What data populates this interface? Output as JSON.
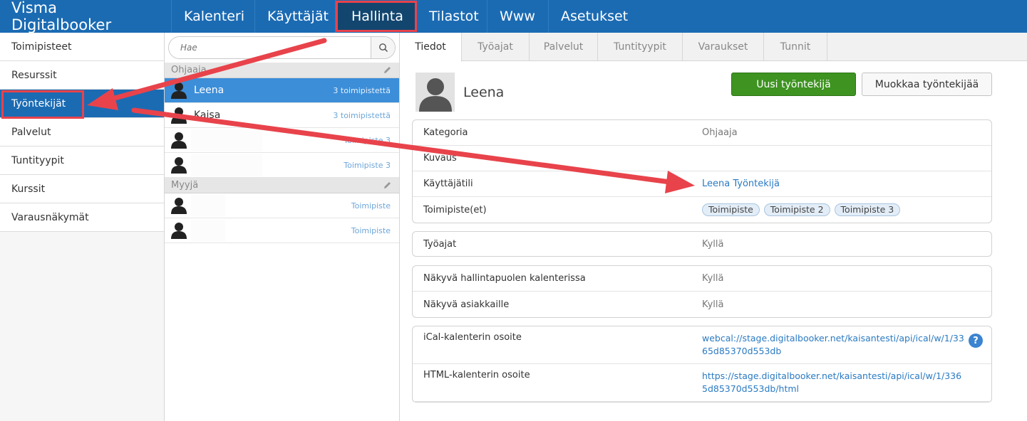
{
  "nav": {
    "brand": "Visma Digitalbooker",
    "items": [
      {
        "label": "Kalenteri"
      },
      {
        "label": "Käyttäjät"
      },
      {
        "label": "Hallinta"
      },
      {
        "label": "Tilastot"
      },
      {
        "label": "Www"
      },
      {
        "label": "Asetukset"
      }
    ]
  },
  "sidebar": {
    "items": [
      {
        "label": "Toimipisteet"
      },
      {
        "label": "Resurssit"
      },
      {
        "label": "Työntekijät"
      },
      {
        "label": "Palvelut"
      },
      {
        "label": "Tuntityypit"
      },
      {
        "label": "Kurssit"
      },
      {
        "label": "Varausnäkymät"
      }
    ]
  },
  "search": {
    "placeholder": "Hae"
  },
  "groups": [
    {
      "name": "Ohjaaja",
      "employees": [
        {
          "name": "Leena",
          "locations": "3 toimipistettä"
        },
        {
          "name": "Kaisa",
          "locations": "3 toimipistettä"
        },
        {
          "name": "",
          "locations": "Toimipiste 3"
        },
        {
          "name": "",
          "locations": "Toimipiste 3"
        }
      ]
    },
    {
      "name": "Myyjä",
      "employees": [
        {
          "name": "",
          "locations": "Toimipiste"
        },
        {
          "name": "",
          "locations": "Toimipiste"
        }
      ]
    }
  ],
  "tabs": [
    {
      "label": "Tiedot"
    },
    {
      "label": "Työajat"
    },
    {
      "label": "Palvelut"
    },
    {
      "label": "Tuntityypit"
    },
    {
      "label": "Varaukset"
    },
    {
      "label": "Tunnit"
    }
  ],
  "profile": {
    "name": "Leena",
    "new_button": "Uusi työntekijä",
    "edit_button": "Muokkaa työntekijää"
  },
  "details": {
    "kategoria_label": "Kategoria",
    "kategoria_value": "Ohjaaja",
    "kuvaus_label": "Kuvaus",
    "kuvaus_value": "",
    "kayttajatili_label": "Käyttäjätili",
    "kayttajatili_value": "Leena Työntekijä",
    "toimipisteet_label": "Toimipiste(et)",
    "toimipisteet_tags": [
      "Toimipiste",
      "Toimipiste 2",
      "Toimipiste 3"
    ]
  },
  "tyoajat": {
    "label": "Työajat",
    "value": "Kyllä"
  },
  "visibility": {
    "admin_label": "Näkyvä hallintapuolen kalenterissa",
    "admin_value": "Kyllä",
    "customer_label": "Näkyvä asiakkaille",
    "customer_value": "Kyllä"
  },
  "calendar": {
    "ical_label": "iCal-kalenterin osoite",
    "ical_url": "webcal://stage.digitalbooker.net/kaisantesti/api/ical/w/1/3365d85370d553db",
    "html_label": "HTML-kalenterin osoite",
    "html_url": "https://stage.digitalbooker.net/kaisantesti/api/ical/w/1/3365d85370d553db/html",
    "help": "?"
  },
  "colors": {
    "nav_bg": "#1b6bb3",
    "active_nav": "#12466f",
    "highlight_red": "#e8434b",
    "selected_row": "#3c8ed9",
    "green_button": "#3e9321",
    "link": "#2a7ac2"
  }
}
